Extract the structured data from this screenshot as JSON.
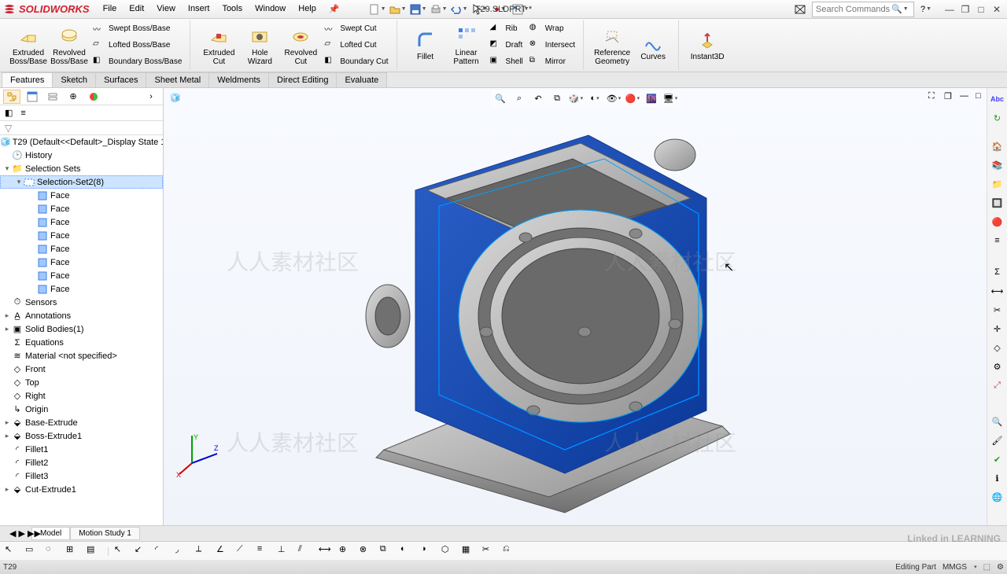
{
  "app": {
    "brand": "SOLIDWORKS",
    "doc": "T29.SLDPRT *"
  },
  "menu": [
    "File",
    "Edit",
    "View",
    "Insert",
    "Tools",
    "Window",
    "Help"
  ],
  "search": {
    "placeholder": "Search Commands"
  },
  "ribbon": {
    "big1": "Extruded Boss/Base",
    "big2": "Revolved Boss/Base",
    "s1": "Swept Boss/Base",
    "s2": "Lofted Boss/Base",
    "s3": "Boundary Boss/Base",
    "big3": "Extruded Cut",
    "big4": "Hole Wizard",
    "big5": "Revolved Cut",
    "s4": "Swept Cut",
    "s5": "Lofted Cut",
    "s6": "Boundary Cut",
    "big6": "Fillet",
    "big7": "Linear Pattern",
    "s7": "Rib",
    "s8": "Draft",
    "s9": "Shell",
    "s10": "Wrap",
    "s11": "Intersect",
    "s12": "Mirror",
    "big8": "Reference Geometry",
    "big9": "Curves",
    "big10": "Instant3D"
  },
  "tabs": [
    "Features",
    "Sketch",
    "Surfaces",
    "Sheet Metal",
    "Weldments",
    "Direct Editing",
    "Evaluate"
  ],
  "tree": {
    "root": "T29  (Default<<Default>_Display State 1",
    "history": "History",
    "selsets": "Selection Sets",
    "selset2": "Selection-Set2(8)",
    "face": "Face",
    "sensors": "Sensors",
    "annot": "Annotations",
    "solid": "Solid Bodies(1)",
    "eqn": "Equations",
    "mat": "Material <not specified>",
    "front": "Front",
    "top": "Top",
    "right": "Right",
    "origin": "Origin",
    "be": "Base-Extrude",
    "be1": "Boss-Extrude1",
    "f1": "Fillet1",
    "f2": "Fillet2",
    "f3": "Fillet3",
    "ce1": "Cut-Extrude1"
  },
  "btabs": {
    "model": "Model",
    "motion": "Motion Study 1"
  },
  "status": {
    "left": "T29",
    "edit": "Editing Part",
    "units": "MMGS"
  },
  "linked": "Linked in LEARNING"
}
